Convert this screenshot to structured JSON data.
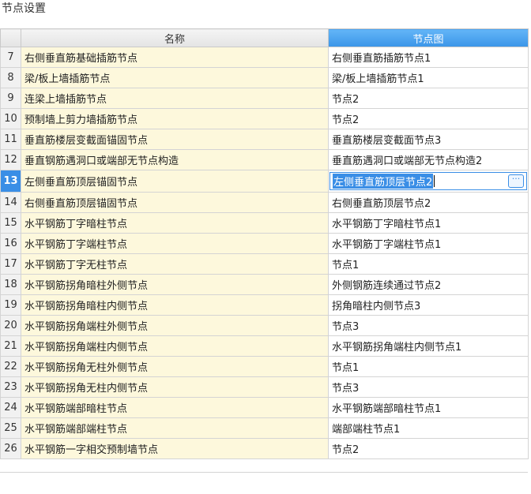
{
  "title": "节点设置",
  "columns": {
    "index": "",
    "name": "名称",
    "node": "节点图"
  },
  "selected_row": 13,
  "more_button_label": "···",
  "rows": [
    {
      "index": "7",
      "name": "右侧垂直筋基础插筋节点",
      "node": "右侧垂直筋插筋节点1"
    },
    {
      "index": "8",
      "name": "梁/板上墙插筋节点",
      "node": "梁/板上墙插筋节点1"
    },
    {
      "index": "9",
      "name": "连梁上墙插筋节点",
      "node": "节点2"
    },
    {
      "index": "10",
      "name": "预制墙上剪力墙插筋节点",
      "node": "节点2"
    },
    {
      "index": "11",
      "name": "垂直筋楼层变截面锚固节点",
      "node": "垂直筋楼层变截面节点3"
    },
    {
      "index": "12",
      "name": "垂直钢筋遇洞口或端部无节点构造",
      "node": "垂直筋遇洞口或端部无节点构造2"
    },
    {
      "index": "13",
      "name": "左侧垂直筋顶层锚固节点",
      "node": "左侧垂直筋顶层节点2"
    },
    {
      "index": "14",
      "name": "右侧垂直筋顶层锚固节点",
      "node": "右侧垂直筋顶层节点2"
    },
    {
      "index": "15",
      "name": "水平钢筋丁字暗柱节点",
      "node": "水平钢筋丁字暗柱节点1"
    },
    {
      "index": "16",
      "name": "水平钢筋丁字端柱节点",
      "node": "水平钢筋丁字端柱节点1"
    },
    {
      "index": "17",
      "name": "水平钢筋丁字无柱节点",
      "node": "节点1"
    },
    {
      "index": "18",
      "name": "水平钢筋拐角暗柱外侧节点",
      "node": "外侧钢筋连续通过节点2"
    },
    {
      "index": "19",
      "name": "水平钢筋拐角暗柱内侧节点",
      "node": "拐角暗柱内侧节点3"
    },
    {
      "index": "20",
      "name": "水平钢筋拐角端柱外侧节点",
      "node": "节点3"
    },
    {
      "index": "21",
      "name": "水平钢筋拐角端柱内侧节点",
      "node": "水平钢筋拐角端柱内侧节点1"
    },
    {
      "index": "22",
      "name": "水平钢筋拐角无柱外侧节点",
      "node": "节点1"
    },
    {
      "index": "23",
      "name": "水平钢筋拐角无柱内侧节点",
      "node": "节点3"
    },
    {
      "index": "24",
      "name": "水平钢筋端部暗柱节点",
      "node": "水平钢筋端部暗柱节点1"
    },
    {
      "index": "25",
      "name": "水平钢筋端部端柱节点",
      "node": "端部端柱节点1"
    },
    {
      "index": "26",
      "name": "水平钢筋一字相交预制墙节点",
      "node": "节点2"
    }
  ]
}
